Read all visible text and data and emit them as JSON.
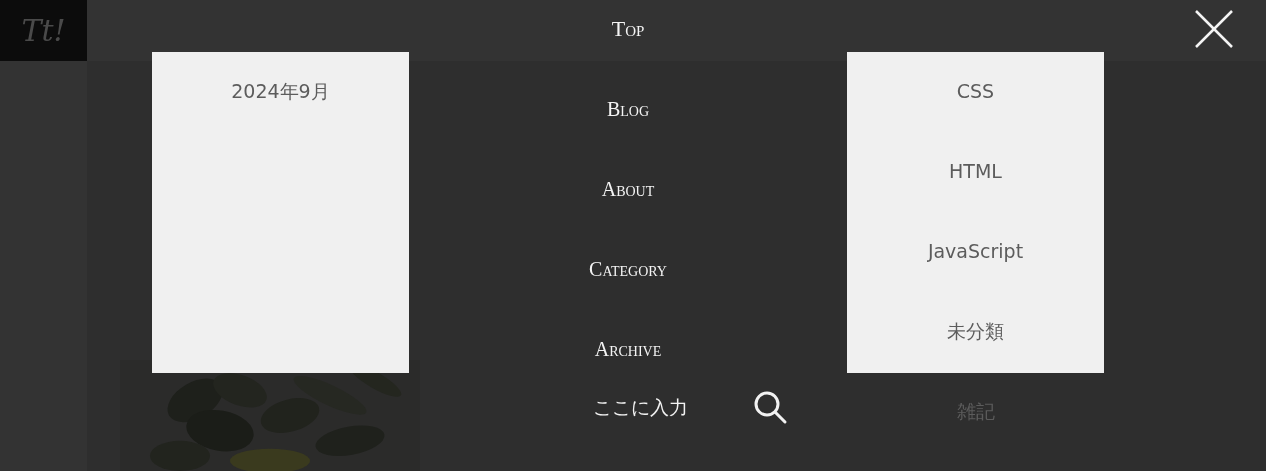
{
  "logo": "Tt!",
  "menu": [
    {
      "label": "Top"
    },
    {
      "label": "Blog"
    },
    {
      "label": "About"
    },
    {
      "label": "Category"
    },
    {
      "label": "Archive"
    }
  ],
  "search": {
    "placeholder": "ここに入力"
  },
  "archives": [
    "2024年9月"
  ],
  "categories": [
    "CSS",
    "HTML",
    "JavaScript",
    "未分類",
    "雑記"
  ]
}
